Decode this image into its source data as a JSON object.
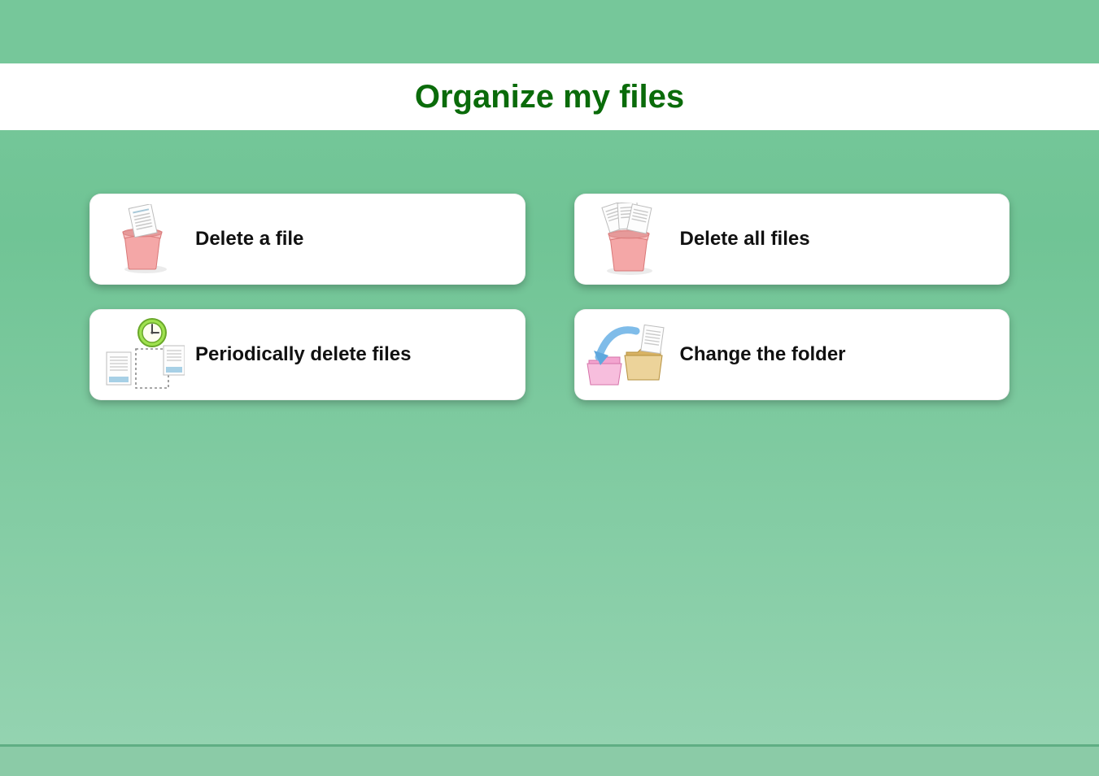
{
  "header": {
    "title": "Organize my files"
  },
  "cards": {
    "delete_file": {
      "label": "Delete a file",
      "icon": "trash-file-icon"
    },
    "delete_all": {
      "label": "Delete all files",
      "icon": "trash-files-icon"
    },
    "periodic_delete": {
      "label": "Periodically delete files",
      "icon": "clock-files-icon"
    },
    "change_folder": {
      "label": "Change the folder",
      "icon": "move-folder-icon"
    }
  }
}
